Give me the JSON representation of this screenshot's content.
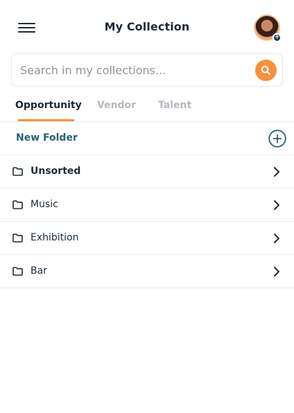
{
  "header": {
    "title": "My Collection",
    "menu_icon": "hamburger-menu-icon",
    "avatar_badge": "+"
  },
  "search": {
    "placeholder": "Search in my collections...",
    "value": "",
    "icon": "search-icon"
  },
  "tabs": [
    {
      "label": "Opportunity",
      "active": true
    },
    {
      "label": "Vendor",
      "active": false
    },
    {
      "label": "Talent",
      "active": false
    }
  ],
  "new_folder": {
    "label": "New Folder",
    "icon": "plus-circle-icon"
  },
  "folders": [
    {
      "name": "Unsorted",
      "bold": true
    },
    {
      "name": "Music",
      "bold": false
    },
    {
      "name": "Exhibition",
      "bold": false
    },
    {
      "name": "Bar",
      "bold": false
    }
  ],
  "colors": {
    "accent": "#f6923f",
    "primary_text": "#1b2a3a",
    "link": "#2a5f75",
    "inactive_tab": "#b4b9bf"
  }
}
